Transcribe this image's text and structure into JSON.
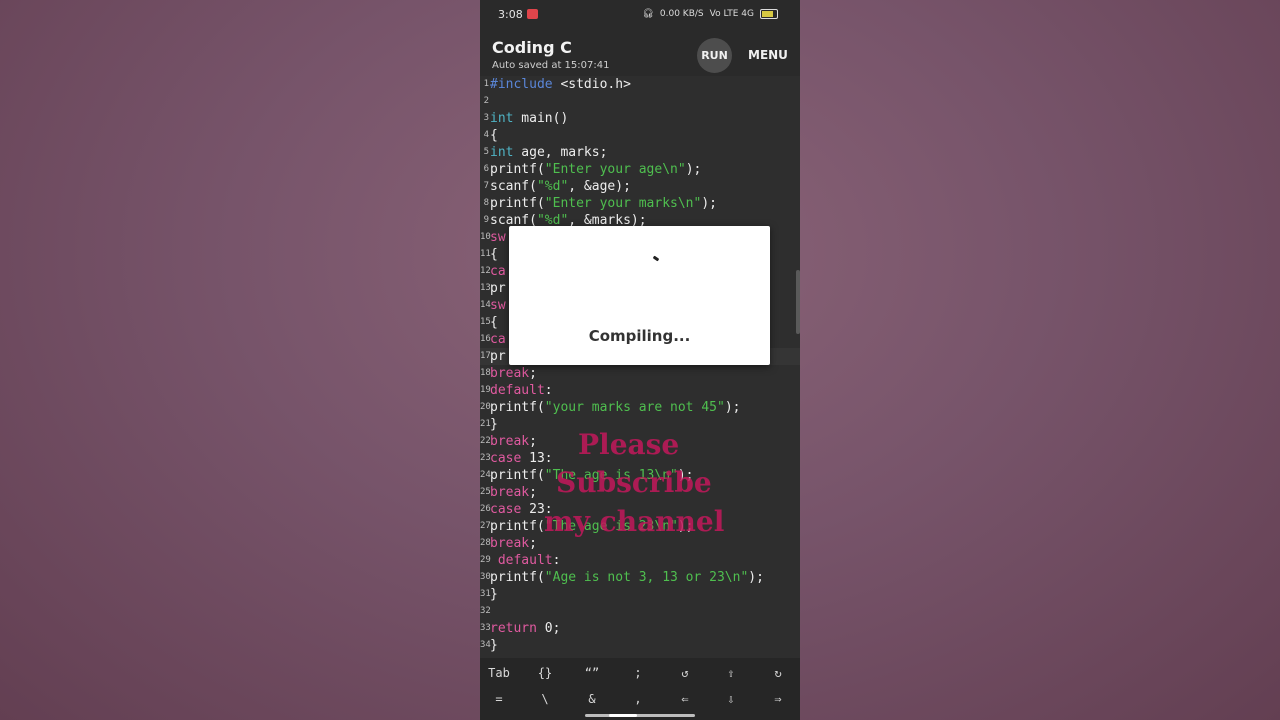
{
  "status_bar": {
    "time": "3:08",
    "network": "0.00 KB/S",
    "signal": "Vo LTE 4G"
  },
  "app": {
    "title": "Coding C",
    "subtitle": "Auto saved at 15:07:41"
  },
  "toolbar": {
    "run_label": "RUN",
    "menu_label": "MENU"
  },
  "code_lines": [
    {
      "n": "1",
      "parts": [
        {
          "t": "#include",
          "c": "pre"
        },
        {
          "t": " <stdio.h>",
          "c": ""
        }
      ]
    },
    {
      "n": "2",
      "parts": []
    },
    {
      "n": "3",
      "parts": [
        {
          "t": "int",
          "c": "type"
        },
        {
          "t": " main()",
          "c": ""
        }
      ]
    },
    {
      "n": "4",
      "parts": [
        {
          "t": "{",
          "c": ""
        }
      ]
    },
    {
      "n": "5",
      "parts": [
        {
          "t": "int",
          "c": "type"
        },
        {
          "t": " age, marks;",
          "c": ""
        }
      ]
    },
    {
      "n": "6",
      "parts": [
        {
          "t": "printf(",
          "c": ""
        },
        {
          "t": "\"Enter your age\\n\"",
          "c": "str"
        },
        {
          "t": ");",
          "c": ""
        }
      ]
    },
    {
      "n": "7",
      "parts": [
        {
          "t": "scanf(",
          "c": ""
        },
        {
          "t": "\"%d\"",
          "c": "str"
        },
        {
          "t": ", &age);",
          "c": ""
        }
      ]
    },
    {
      "n": "8",
      "parts": [
        {
          "t": "printf(",
          "c": ""
        },
        {
          "t": "\"Enter your marks\\n\"",
          "c": "str"
        },
        {
          "t": ");",
          "c": ""
        }
      ]
    },
    {
      "n": "9",
      "parts": [
        {
          "t": "scanf(",
          "c": ""
        },
        {
          "t": "\"%d\"",
          "c": "str"
        },
        {
          "t": ", &marks);",
          "c": ""
        }
      ]
    },
    {
      "n": "10",
      "parts": [
        {
          "t": "sw",
          "c": "kw"
        }
      ]
    },
    {
      "n": "11",
      "parts": [
        {
          "t": "{",
          "c": ""
        }
      ]
    },
    {
      "n": "12",
      "parts": [
        {
          "t": "ca",
          "c": "kw"
        }
      ]
    },
    {
      "n": "13",
      "parts": [
        {
          "t": "pr",
          "c": ""
        }
      ]
    },
    {
      "n": "14",
      "parts": [
        {
          "t": "sw",
          "c": "kw"
        }
      ]
    },
    {
      "n": "15",
      "parts": [
        {
          "t": "{",
          "c": ""
        }
      ]
    },
    {
      "n": "16",
      "parts": [
        {
          "t": "ca",
          "c": "kw"
        }
      ]
    },
    {
      "n": "17",
      "parts": [
        {
          "t": "pr",
          "c": ""
        }
      ]
    },
    {
      "n": "18",
      "parts": [
        {
          "t": "break",
          "c": "kw"
        },
        {
          "t": ";",
          "c": ""
        }
      ]
    },
    {
      "n": "19",
      "parts": [
        {
          "t": "default",
          "c": "kw"
        },
        {
          "t": ":",
          "c": ""
        }
      ]
    },
    {
      "n": "20",
      "parts": [
        {
          "t": "printf(",
          "c": ""
        },
        {
          "t": "\"your marks are not 45\"",
          "c": "str"
        },
        {
          "t": ");",
          "c": ""
        }
      ]
    },
    {
      "n": "21",
      "parts": [
        {
          "t": "}",
          "c": ""
        }
      ]
    },
    {
      "n": "22",
      "parts": [
        {
          "t": "break",
          "c": "kw"
        },
        {
          "t": ";",
          "c": ""
        }
      ]
    },
    {
      "n": "23",
      "parts": [
        {
          "t": "case",
          "c": "kw"
        },
        {
          "t": " 13:",
          "c": ""
        }
      ]
    },
    {
      "n": "24",
      "parts": [
        {
          "t": "printf(",
          "c": ""
        },
        {
          "t": "\"The age is 13\\n\"",
          "c": "str"
        },
        {
          "t": ");",
          "c": ""
        }
      ]
    },
    {
      "n": "25",
      "parts": [
        {
          "t": "break",
          "c": "kw"
        },
        {
          "t": ";",
          "c": ""
        }
      ]
    },
    {
      "n": "26",
      "parts": [
        {
          "t": "case",
          "c": "kw"
        },
        {
          "t": " 23:",
          "c": ""
        }
      ]
    },
    {
      "n": "27",
      "parts": [
        {
          "t": "printf(",
          "c": ""
        },
        {
          "t": "\"The age is 23\\n\"",
          "c": "str"
        },
        {
          "t": ");",
          "c": ""
        }
      ]
    },
    {
      "n": "28",
      "parts": [
        {
          "t": "break",
          "c": "kw"
        },
        {
          "t": ";",
          "c": ""
        }
      ]
    },
    {
      "n": "29",
      "parts": [
        {
          "t": " default",
          "c": "kw"
        },
        {
          "t": ":",
          "c": ""
        }
      ]
    },
    {
      "n": "30",
      "parts": [
        {
          "t": "printf(",
          "c": ""
        },
        {
          "t": "\"Age is not 3, 13 or 23\\n\"",
          "c": "str"
        },
        {
          "t": ");",
          "c": ""
        }
      ]
    },
    {
      "n": "31",
      "parts": [
        {
          "t": "}",
          "c": ""
        }
      ]
    },
    {
      "n": "32",
      "parts": []
    },
    {
      "n": "33",
      "parts": [
        {
          "t": "return",
          "c": "kw"
        },
        {
          "t": " 0;",
          "c": ""
        }
      ]
    },
    {
      "n": "34",
      "parts": [
        {
          "t": "}",
          "c": ""
        }
      ]
    }
  ],
  "dialog": {
    "message": "Compiling..."
  },
  "overlay": {
    "line1": "Please",
    "line2": "Subscribe",
    "line3": "my channel",
    "color": "#c2185b"
  },
  "keyboard_keys": [
    "Tab",
    "{}",
    "“”",
    ";",
    "↺",
    "⇧",
    "↻",
    "=",
    "\\",
    "&",
    ",",
    "⇐",
    "⇩",
    "⇒"
  ],
  "colors": {
    "keyword": "#e05aa0",
    "type": "#4fb3c4",
    "string": "#4fbf4f",
    "preprocessor": "#5a86d8"
  }
}
